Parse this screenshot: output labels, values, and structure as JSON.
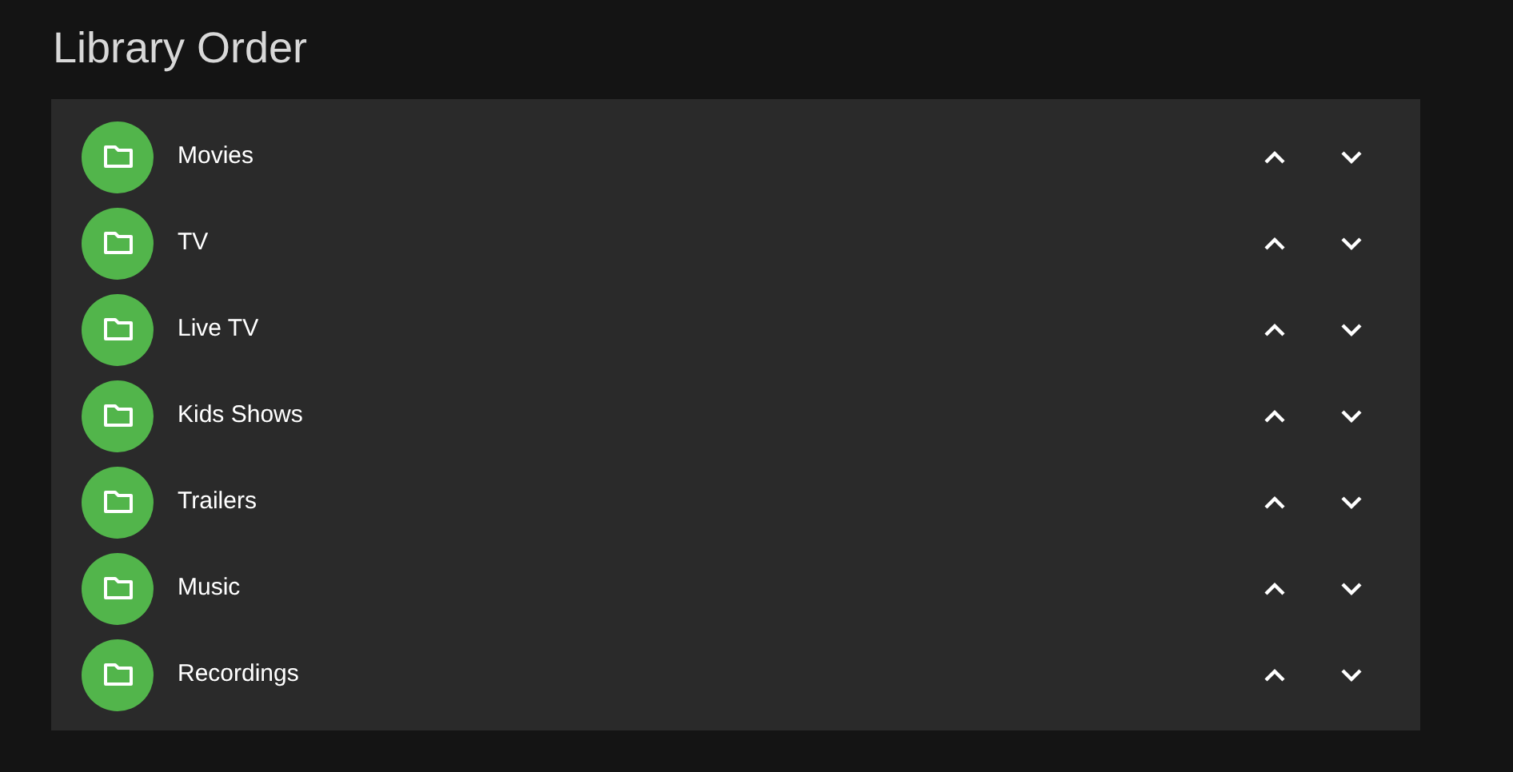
{
  "title": "Library Order",
  "libraries": [
    {
      "name": "Movies"
    },
    {
      "name": "TV"
    },
    {
      "name": "Live TV"
    },
    {
      "name": "Kids Shows"
    },
    {
      "name": "Trailers"
    },
    {
      "name": "Music"
    },
    {
      "name": "Recordings"
    }
  ]
}
